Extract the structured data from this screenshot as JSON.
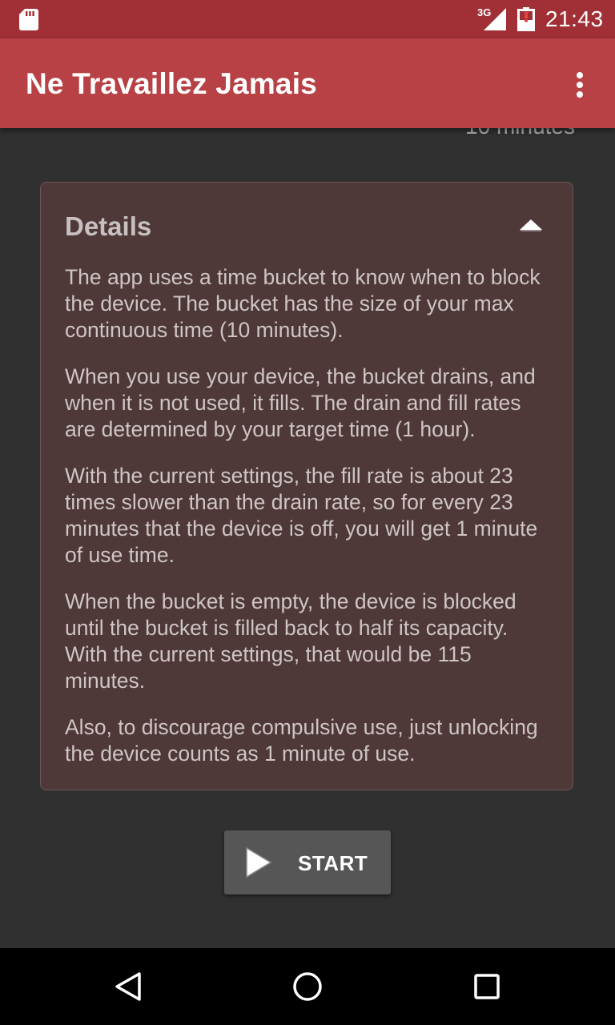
{
  "status_bar": {
    "network_type": "3G",
    "time": "21:43",
    "icons": [
      "sd-card-icon",
      "signal-icon",
      "battery-icon"
    ]
  },
  "app_bar": {
    "title": "Ne Travaillez Jamais",
    "overflow_icon": "more-vert-icon"
  },
  "content": {
    "partial_text_above": "10 minutes",
    "details": {
      "title": "Details",
      "toggle_icon": "chevron-up-icon",
      "paragraphs": [
        "The app uses a time bucket to know when to block the device. The bucket has the size of your max continuous time (10 minutes).",
        "When you use your device, the bucket drains, and when it is not used, it fills. The drain and fill rates are determined by your target time (1 hour).",
        "With the current settings, the fill rate is about 23 times slower than the drain rate, so for every 23 minutes that the device is off, you will get 1 minute of use time.",
        "When the bucket is empty, the device is blocked until the bucket is filled back to half its capacity. With the current settings, that would be 115 minutes.",
        "Also, to discourage compulsive use, just unlocking the device counts as 1 minute of use."
      ]
    },
    "start_button": {
      "label": "START",
      "icon": "play-icon"
    }
  },
  "nav_bar": {
    "icons": [
      "back-icon",
      "home-icon",
      "recents-icon"
    ]
  },
  "colors": {
    "status_bar": "#a03035",
    "app_bar": "#b74144",
    "background": "#303030",
    "card": "#4e3838",
    "button": "#565656"
  }
}
